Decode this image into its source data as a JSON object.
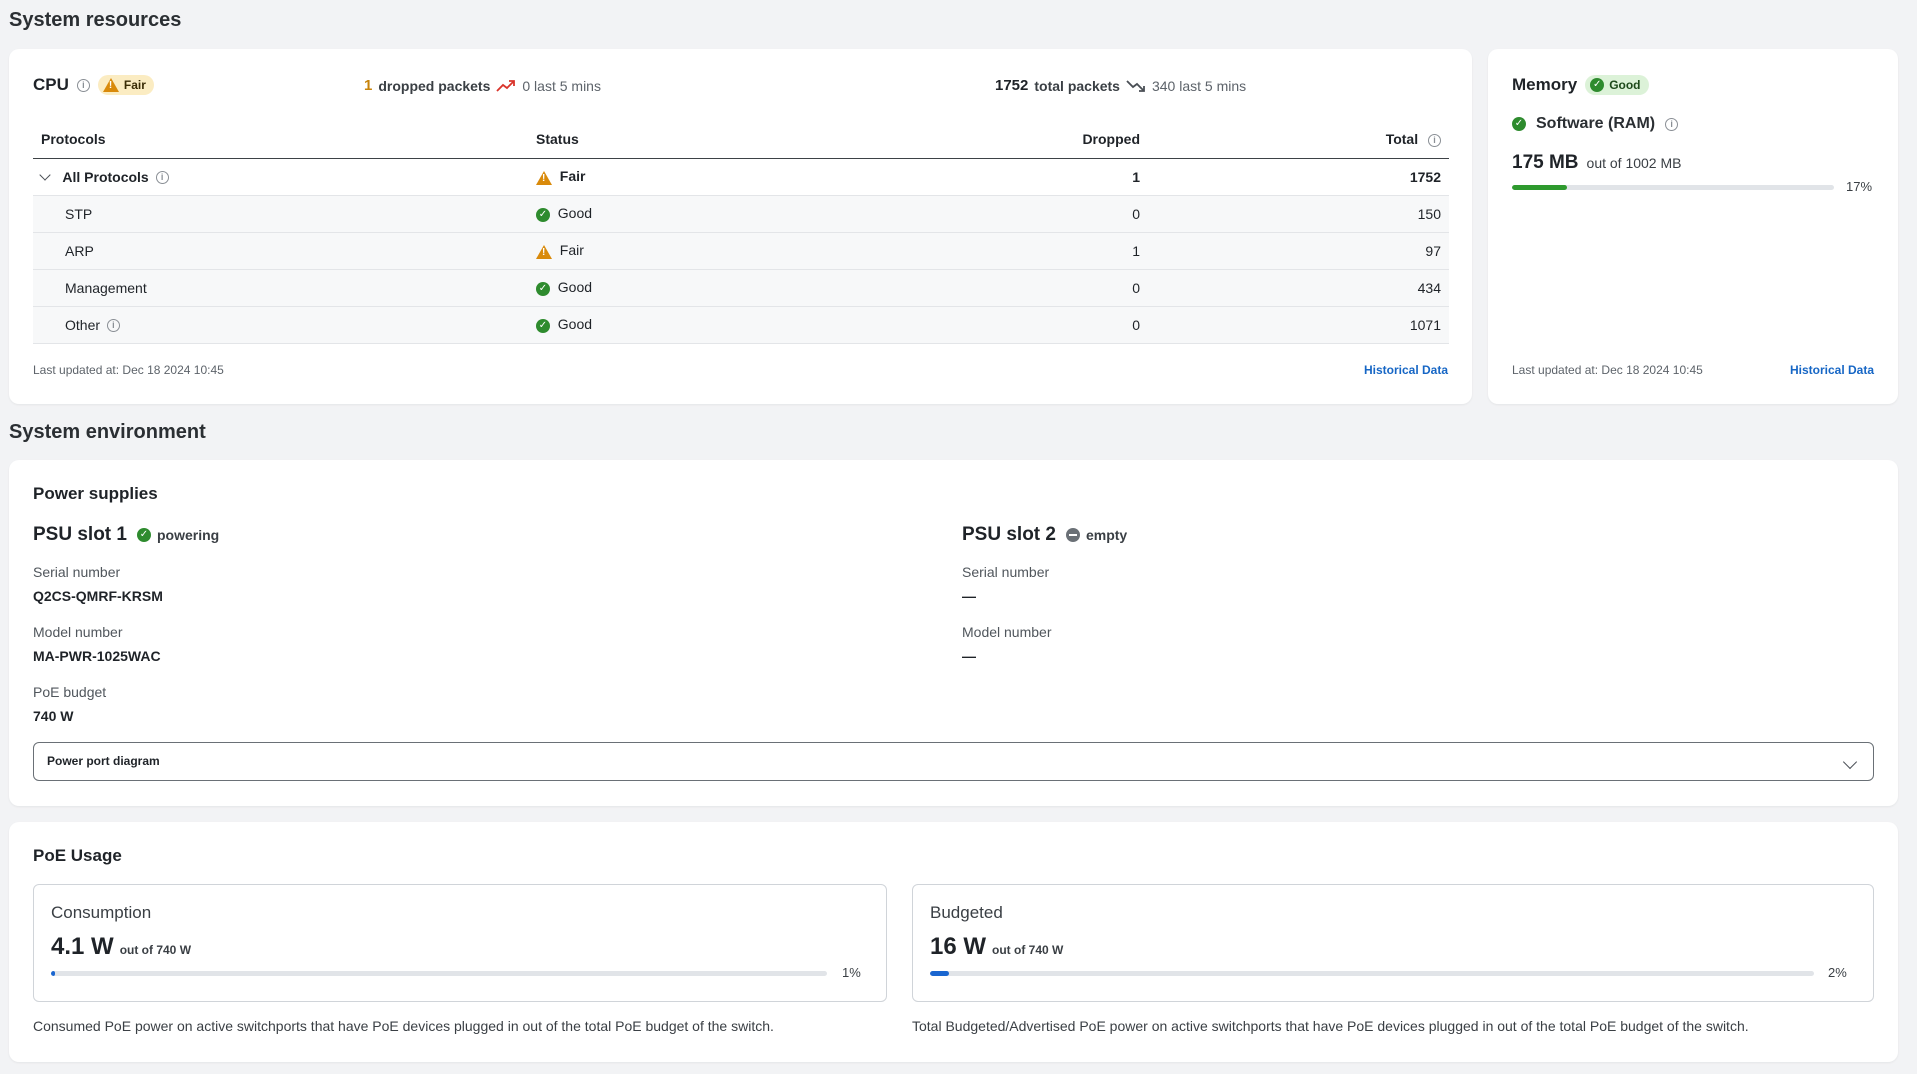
{
  "system_resources": {
    "title": "System resources",
    "cpu": {
      "title": "CPU",
      "status": "Fair",
      "dropped_count": "1",
      "dropped_label": "dropped packets",
      "dropped_trend": "0 last 5 mins",
      "total_count": "1752",
      "total_label": "total packets",
      "total_trend": "340 last 5 mins",
      "columns": [
        "Protocols",
        "Status",
        "Dropped",
        "Total"
      ],
      "rows": [
        {
          "protocol": "All Protocols",
          "status": "Fair",
          "dropped": "1",
          "total": "1752"
        },
        {
          "protocol": "STP",
          "status": "Good",
          "dropped": "0",
          "total": "150"
        },
        {
          "protocol": "ARP",
          "status": "Fair",
          "dropped": "1",
          "total": "97"
        },
        {
          "protocol": "Management",
          "status": "Good",
          "dropped": "0",
          "total": "434"
        },
        {
          "protocol": "Other",
          "status": "Good",
          "dropped": "0",
          "total": "1071"
        }
      ],
      "last_updated": "Last updated at: Dec 18 2024 10:45",
      "historical_link": "Historical Data"
    },
    "memory": {
      "title": "Memory",
      "status": "Good",
      "software_label": "Software (RAM)",
      "used": "175 MB",
      "out_of": "out of 1002 MB",
      "percent": "17%",
      "fill_fraction": 0.17,
      "last_updated": "Last updated at: Dec 18 2024 10:45",
      "historical_link": "Historical Data"
    }
  },
  "system_environment": {
    "title": "System environment",
    "power_supplies": {
      "title": "Power supplies",
      "psu1": {
        "title": "PSU slot 1",
        "status": "powering",
        "serial_label": "Serial number",
        "serial": "Q2CS-QMRF-KRSM",
        "model_label": "Model number",
        "model": "MA-PWR-1025WAC",
        "poe_label": "PoE budget",
        "poe": "740 W"
      },
      "psu2": {
        "title": "PSU slot 2",
        "status": "empty",
        "serial_label": "Serial number",
        "serial": "—",
        "model_label": "Model number",
        "model": "—"
      },
      "diagram_toggle": "Power port diagram"
    },
    "poe_usage": {
      "title": "PoE Usage",
      "consumption": {
        "title": "Consumption",
        "value": "4.1 W",
        "out_of": "out of 740 W",
        "percent": "1%",
        "fill_fraction": 0.005,
        "description": "Consumed PoE power on active switchports that have PoE devices plugged in out of the total PoE budget of the switch."
      },
      "budgeted": {
        "title": "Budgeted",
        "value": "16 W",
        "out_of": "out of 740 W",
        "percent": "2%",
        "fill_fraction": 0.022,
        "description": "Total Budgeted/Advertised PoE power on active switchports that have PoE devices plugged in out of the total PoE budget of the switch."
      }
    }
  },
  "colors": {
    "good": "#2e8b2e",
    "fair": "#d98a0b",
    "link": "#1666c5",
    "memory_bar": "#2e9a2e",
    "poe_bar": "#1a66d0"
  }
}
